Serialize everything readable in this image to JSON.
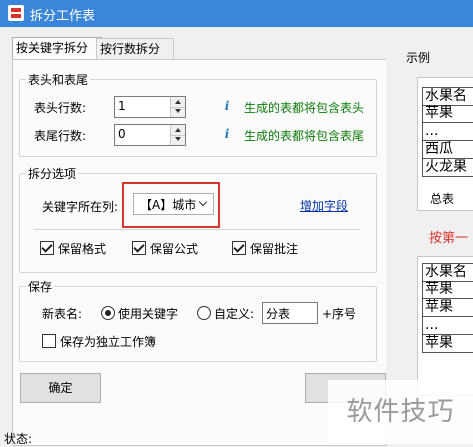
{
  "window": {
    "title": "拆分工作表"
  },
  "tabs": [
    {
      "label": "按关键字拆分",
      "active": true
    },
    {
      "label": "按行数拆分",
      "active": false
    }
  ],
  "header_footer": {
    "title": "表头和表尾",
    "header_label": "表头行数:",
    "header_value": "1",
    "header_hint": "生成的表都将包含表头",
    "footer_label": "表尾行数:",
    "footer_value": "0",
    "footer_hint": "生成的表都将包含表尾"
  },
  "split_options": {
    "title": "拆分选项",
    "key_column_label": "关键字所在列:",
    "key_column_value": "【A】城市",
    "add_field_link": "增加字段",
    "keep_format": {
      "label": "保留格式",
      "checked": true
    },
    "keep_formula": {
      "label": "保留公式",
      "checked": true
    },
    "keep_comment": {
      "label": "保留批注",
      "checked": true
    }
  },
  "save": {
    "title": "保存",
    "new_sheet_name_label": "新表名:",
    "use_keyword": {
      "label": "使用关键字",
      "checked": true
    },
    "custom": {
      "label": "自定义:",
      "checked": false
    },
    "custom_value": "分表",
    "suffix_label": "+序号",
    "save_workbook": {
      "label": "保存为独立工作簿",
      "checked": false
    }
  },
  "buttons": {
    "ok": "确定"
  },
  "status": {
    "label": "状态:"
  },
  "example": {
    "title": "示例",
    "table1": [
      "水果名",
      "苹果",
      "...",
      "西瓜",
      "火龙果"
    ],
    "sheet_tab": "总表",
    "caption": "按第一",
    "table2": [
      "水果名",
      "苹果",
      "苹果",
      "...",
      "苹果"
    ]
  },
  "watermark": "软件技巧",
  "colors": {
    "titlebar": "#3b86d8",
    "hint_green": "#0a7a0a",
    "highlight_red": "#d9342b",
    "link_blue": "#0033aa"
  }
}
